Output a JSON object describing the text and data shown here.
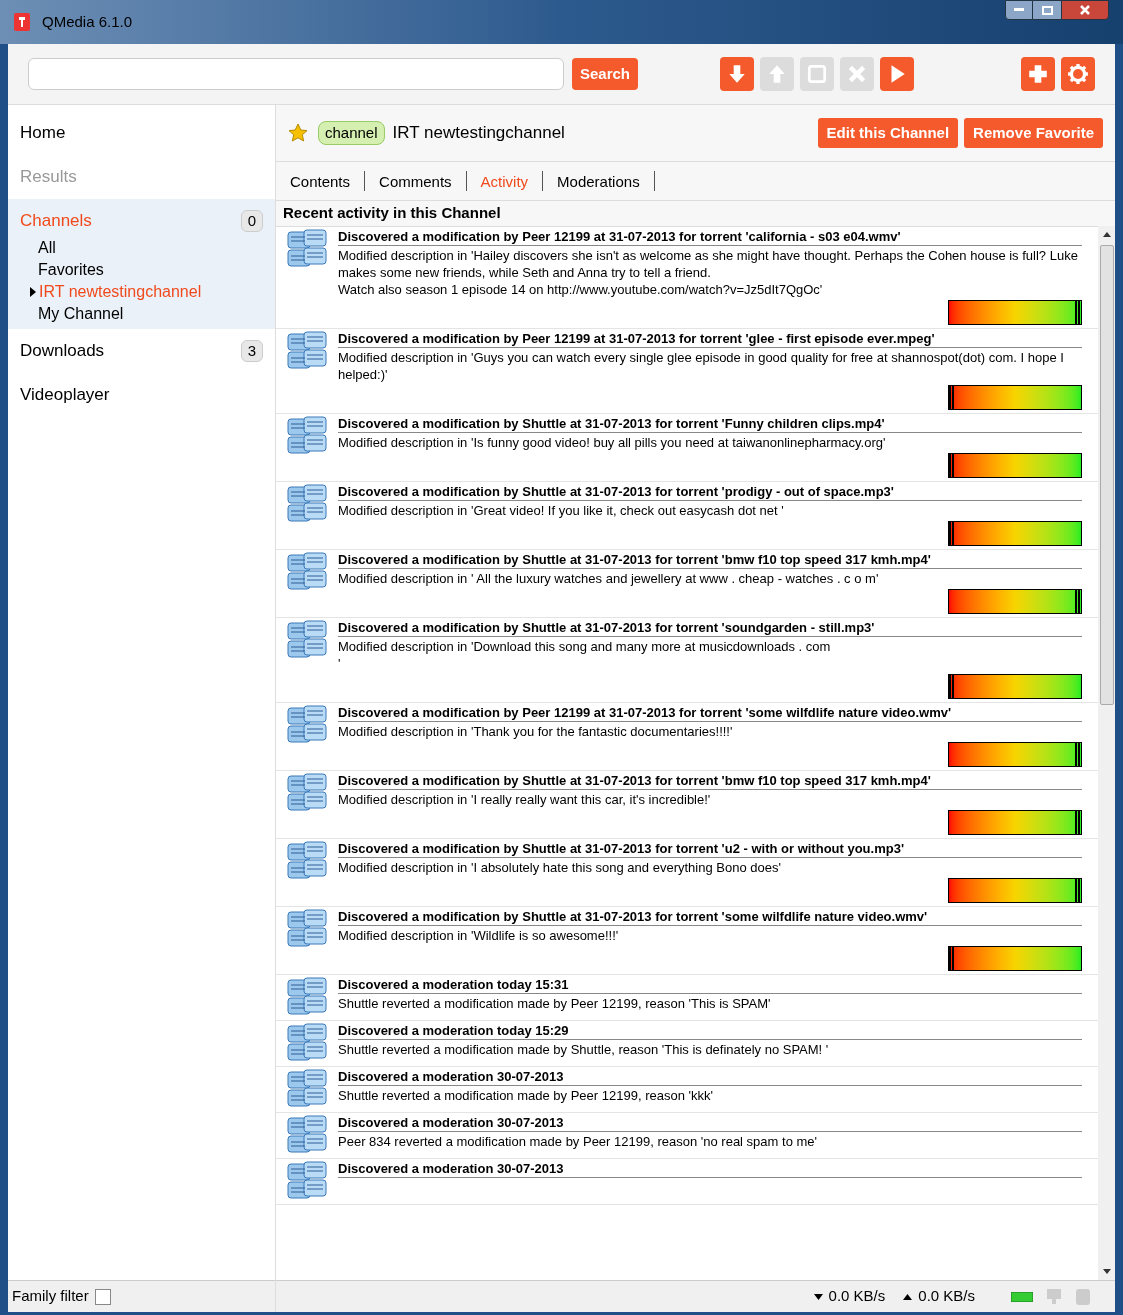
{
  "window": {
    "title": "QMedia 6.1.0"
  },
  "toolbar": {
    "search_button": "Search",
    "buttons": [
      {
        "kind": "download",
        "disabled": false
      },
      {
        "kind": "upload",
        "disabled": true
      },
      {
        "kind": "stop",
        "disabled": true
      },
      {
        "kind": "remove",
        "disabled": true
      },
      {
        "kind": "play",
        "disabled": false
      },
      {
        "kind": "add",
        "disabled": false
      },
      {
        "kind": "settings",
        "disabled": false
      }
    ]
  },
  "sidebar": {
    "items": [
      {
        "label": "Home",
        "selected": false,
        "disabled": false
      },
      {
        "label": "Results",
        "selected": false,
        "disabled": true
      },
      {
        "label": "Channels",
        "selected": true,
        "disabled": false,
        "count": "0",
        "children": [
          {
            "label": "All",
            "selected": false
          },
          {
            "label": "Favorites",
            "selected": false
          },
          {
            "label": "IRT newtestingchannel",
            "selected": true
          },
          {
            "label": "My Channel",
            "selected": false
          }
        ]
      },
      {
        "label": "Downloads",
        "selected": false,
        "disabled": false,
        "count": "3"
      },
      {
        "label": "Videoplayer",
        "selected": false,
        "disabled": false
      }
    ]
  },
  "channel_header": {
    "tag": "channel",
    "name": "IRT newtestingchannel",
    "buttons": [
      "Edit this Channel",
      "Remove Favorite"
    ]
  },
  "tabs": [
    {
      "label": "Contents",
      "selected": false
    },
    {
      "label": "Comments",
      "selected": false
    },
    {
      "label": "Activity",
      "selected": true
    },
    {
      "label": "Moderations",
      "selected": false
    }
  ],
  "activity": {
    "title": "Recent activity in this Channel",
    "items": [
      {
        "kind": "modification",
        "title": "Discovered a modification by Peer 12199 at 31-07-2013 for torrent 'california - s03 e04.wmv'",
        "text": "Modified description in 'Hailey discovers she isn't as welcome as she might have thought. Perhaps the Cohen house is full? Luke makes some new friends, while Seth and Anna try to tell a friend.\nWatch also season 1  episode 14 on http://www.youtube.com/watch?v=Jz5dIt7QgOc'",
        "level": 0.98
      },
      {
        "kind": "modification",
        "title": "Discovered a modification by Peer 12199 at 31-07-2013 for torrent 'glee - first episode ever.mpeg'",
        "text": "Modified description in 'Guys you can watch every single glee episode in good quality for free at shannospot(dot) com. I hope I helped:)'",
        "level": 0.02
      },
      {
        "kind": "modification",
        "title": "Discovered a modification by Shuttle at 31-07-2013 for torrent 'Funny children clips.mp4'",
        "text": "Modified description in 'Is funny good video! buy all pills you need at taiwanonlinepharmacy.org'",
        "level": 0.02
      },
      {
        "kind": "modification",
        "title": "Discovered a modification by Shuttle at 31-07-2013 for torrent 'prodigy - out of space.mp3'",
        "text": "Modified description in 'Great video! If you like it, check out easycash dot net '",
        "level": 0.02
      },
      {
        "kind": "modification",
        "title": "Discovered a modification by Shuttle at 31-07-2013 for torrent 'bmw f10 top speed 317 kmh.mp4'",
        "text": "Modified description in '  All the luxury watches and jewellery at www . cheap - watches . c o m'",
        "level": 0.98
      },
      {
        "kind": "modification",
        "title": "Discovered a modification by Shuttle at 31-07-2013 for torrent 'soundgarden - still.mp3'",
        "text": "Modified description in 'Download this song and many more at musicdownloads . com\n'",
        "level": 0.02
      },
      {
        "kind": "modification",
        "title": "Discovered a modification by Peer 12199 at 31-07-2013 for torrent 'some wilfdlife nature video.wmv'",
        "text": "Modified description in 'Thank  you for the fantastic documentaries!!!!'",
        "level": 0.98
      },
      {
        "kind": "modification",
        "title": "Discovered a modification by Shuttle at 31-07-2013 for torrent 'bmw f10 top speed 317 kmh.mp4'",
        "text": "Modified description in 'I really really want this car, it's incredible!'",
        "level": 0.98
      },
      {
        "kind": "modification",
        "title": "Discovered a modification by Shuttle at 31-07-2013 for torrent 'u2 - with or without you.mp3'",
        "text": "Modified description in 'I absolutely hate this song and everything Bono does'",
        "level": 0.98
      },
      {
        "kind": "modification",
        "title": "Discovered a modification by Shuttle at 31-07-2013 for torrent 'some wilfdlife nature video.wmv'",
        "text": "Modified description in 'Wildlife is so awesome!!!'",
        "level": 0.02
      },
      {
        "kind": "moderation",
        "title": "Discovered a moderation today 15:31",
        "text": "Shuttle reverted a modification made by Peer 12199, reason 'This is SPAM'"
      },
      {
        "kind": "moderation",
        "title": "Discovered a moderation today 15:29",
        "text": "Shuttle reverted a modification made by Shuttle, reason 'This is definately no SPAM! '"
      },
      {
        "kind": "moderation",
        "title": "Discovered a moderation 30-07-2013",
        "text": "Shuttle reverted a modification made by Peer 12199, reason 'kkk'"
      },
      {
        "kind": "moderation",
        "title": "Discovered a moderation 30-07-2013",
        "text": "Peer 834 reverted a modification made by Peer 12199, reason 'no real spam to me'"
      },
      {
        "kind": "moderation",
        "title": "Discovered a moderation 30-07-2013"
      }
    ]
  },
  "status_bar": {
    "family_filter": {
      "label": "Family filter",
      "checked": false
    },
    "download_speed": "0.0 KB/s",
    "upload_speed": "0.0 KB/s"
  }
}
